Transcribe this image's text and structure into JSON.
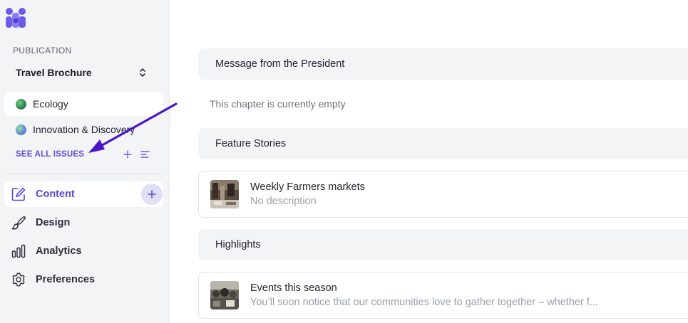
{
  "app": {
    "logo_icon": "app-logo-icon",
    "accent_color": "#5548d9"
  },
  "sidebar": {
    "publication_caption": "PUBLICATION",
    "publication_name": "Travel Brochure",
    "issues": [
      {
        "label": "Ecology",
        "active": true,
        "dot_color": "#3f9c5a"
      },
      {
        "label": "Innovation & Discovery",
        "active": false,
        "dot_color": "#6f64d8"
      }
    ],
    "see_all_label": "SEE ALL ISSUES",
    "nav": [
      {
        "label": "Content",
        "icon": "edit-icon",
        "active": true
      },
      {
        "label": "Design",
        "icon": "brush-icon",
        "active": false
      },
      {
        "label": "Analytics",
        "icon": "bar-chart-icon",
        "active": false
      },
      {
        "label": "Preferences",
        "icon": "gear-icon",
        "active": false
      }
    ]
  },
  "main": {
    "chapters": [
      {
        "title": "Message from the President",
        "empty_note": "This chapter is currently empty"
      },
      {
        "title": "Feature Stories",
        "stories": [
          {
            "title": "Weekly Farmers markets",
            "description": "No description"
          }
        ]
      },
      {
        "title": "Highlights",
        "stories": [
          {
            "title": "Events this season",
            "description": "You’ll soon notice that our communities love to gather together – whether f..."
          }
        ]
      }
    ]
  }
}
